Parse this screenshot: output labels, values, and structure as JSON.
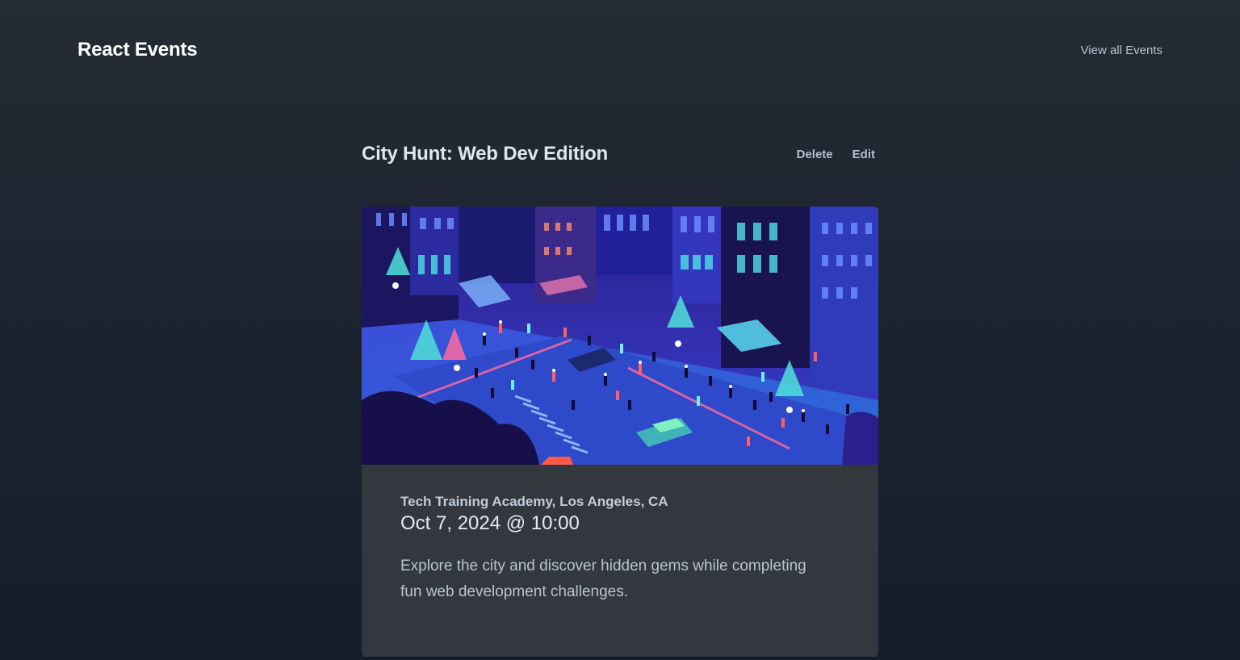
{
  "header": {
    "brand": "React Events",
    "nav_link": "View all Events"
  },
  "event": {
    "title": "City Hunt: Web Dev Edition",
    "actions": {
      "delete_label": "Delete",
      "edit_label": "Edit"
    },
    "image_alt": "City Hunt: Web Dev Edition",
    "location": "Tech Training Academy, Los Angeles, CA",
    "datetime": "Oct 7, 2024 @ 10:00",
    "description": "Explore the city and discover hidden gems while completing fun web development challenges."
  },
  "colors": {
    "background_top": "#242b33",
    "background_bottom": "#151c2c",
    "card": "#33383e"
  }
}
